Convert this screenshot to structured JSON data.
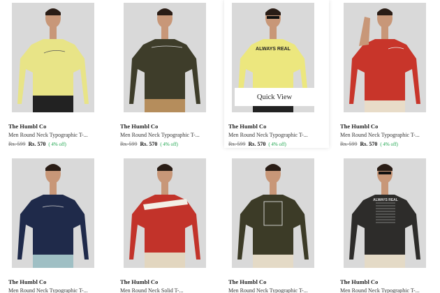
{
  "products": [
    {
      "brand": "The Humbl Co",
      "name": "Men Round Neck Typographic T-...",
      "mrp": "Rs. 599",
      "price": "Rs. 570",
      "discount": "( 4% off)",
      "shirt_color": "#e8e487",
      "print": "script"
    },
    {
      "brand": "The Humbl Co",
      "name": "Men Round Neck Typographic T-...",
      "mrp": "Rs. 599",
      "price": "Rs. 570",
      "discount": "( 4% off)",
      "shirt_color": "#3e3d2a",
      "print": "script"
    },
    {
      "brand": "The Humbl Co",
      "name": "Men Round Neck Typographic T-...",
      "mrp": "Rs. 599",
      "price": "Rs. 570",
      "discount": "( 4% off)",
      "shirt_color": "#ece77e",
      "print": "ALWAYS REAL"
    },
    {
      "brand": "The Humbl Co",
      "name": "Men Round Neck Typographic T-...",
      "mrp": "Rs. 599",
      "price": "Rs. 570",
      "discount": "( 4% off)",
      "shirt_color": "#c8352a",
      "print": "script"
    },
    {
      "brand": "The Humbl Co",
      "name": "Men Round Neck Typographic T-...",
      "shirt_color": "#1f2a4a",
      "print": "script"
    },
    {
      "brand": "The Humbl Co",
      "name": "Men Round Neck Solid T-...",
      "shirt_color": "#c2332a",
      "print": "stripe"
    },
    {
      "brand": "The Humbl Co",
      "name": "Men Round Neck Typographic T-...",
      "shirt_color": "#3c3b27",
      "print": "box"
    },
    {
      "brand": "The Humbl Co",
      "name": "Men Round Neck Typographic T-...",
      "shirt_color": "#2d2c2a",
      "print": "ALWAYS REAL"
    }
  ],
  "quick_view_label": "Quick View"
}
